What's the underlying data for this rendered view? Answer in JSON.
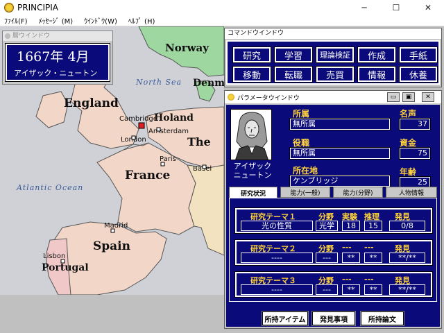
{
  "app": {
    "title": "PRINCIPIA",
    "min": "─",
    "max": "☐",
    "close": "✕"
  },
  "menu": [
    "ﾌｧｲﾙ(F)",
    "ﾒｯｾｰｼﾞ (M)",
    "ｳｲﾝﾄﾞｳ(W)",
    "ﾍﾙﾌﾟ (H)"
  ],
  "date_window": {
    "caption": "暦ウインドウ",
    "date": "1667年  4月",
    "person": "アイザック・ニュートン"
  },
  "map": {
    "labels": {
      "norway": "Norway",
      "north_sea": "North Sea",
      "denmark": "Denm",
      "england": "England",
      "holand": "Holand",
      "amsterdam": "Amsterdam",
      "cambridge": "Cambridge",
      "london": "London",
      "the": "The",
      "paris": "Paris",
      "france": "France",
      "basel": "Basel",
      "atlantic": "Atlantic Ocean",
      "madrid": "Madrid",
      "spain": "Spain",
      "lisbon": "Lisbon",
      "portugal": "Portugal"
    },
    "colors": {
      "sea": "#cfd1d6",
      "land": "#f2d6c8",
      "land2": "#f3e2c0",
      "green": "#9ed8a0"
    }
  },
  "command_window": {
    "caption": "コマンドウインドウ",
    "buttons": [
      "研究",
      "学習",
      "理論検証",
      "作成",
      "手紙",
      "移動",
      "転職",
      "売買",
      "情報",
      "休養"
    ]
  },
  "param_window": {
    "caption": "パラメータウインドウ",
    "btn_min": "▭",
    "btn_restore": "▣",
    "btn_close": "✕",
    "name_line1": "アイザック",
    "name_line2": "ニュートン",
    "labels": {
      "affiliation": "所属",
      "position": "役職",
      "location": "所在地",
      "fame": "名声",
      "funds": "資金",
      "age": "年齢"
    },
    "values": {
      "affiliation": "無所属",
      "position": "無所属",
      "location": "ケンブリッジ",
      "fame": "37",
      "funds": "75",
      "age": "25"
    },
    "tabs": [
      "研究状況",
      "能力(一般)",
      "能力(分野)",
      "人物情報"
    ],
    "research": [
      {
        "title": "研究テーマ１",
        "theme": "光の性質",
        "field_label": "分野",
        "field": "光学",
        "c3": "実験",
        "v3": "18",
        "c4": "推理",
        "v4": "15",
        "disc_label": "発見",
        "disc": "0/8"
      },
      {
        "title": "研究テーマ２",
        "theme": "----",
        "field_label": "分野",
        "field": "---",
        "c3": "---",
        "v3": "**",
        "c4": "---",
        "v4": "**",
        "disc_label": "発見",
        "disc": "**/**"
      },
      {
        "title": "研究テーマ３",
        "theme": "----",
        "field_label": "分野",
        "field": "---",
        "c3": "---",
        "v3": "**",
        "c4": "---",
        "v4": "**",
        "disc_label": "発見",
        "disc": "**/**"
      }
    ],
    "bottom_buttons": [
      "所持アイテム",
      "発見事項",
      "所持論文"
    ]
  }
}
